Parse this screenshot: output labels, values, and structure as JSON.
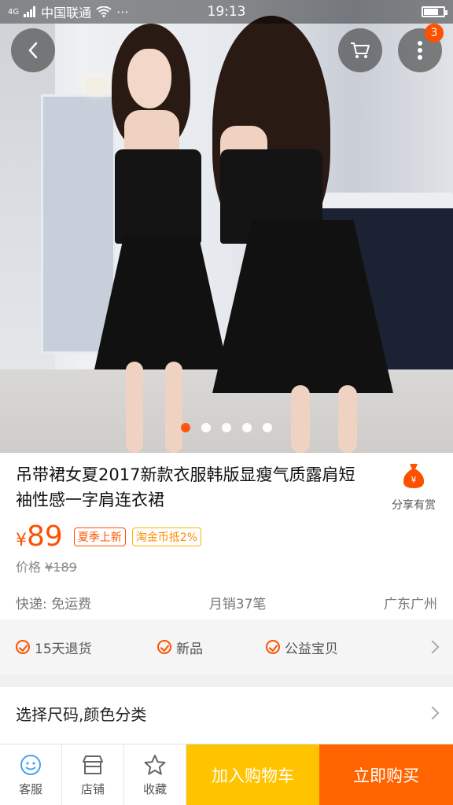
{
  "status_bar": {
    "network": "4G",
    "carrier": "中国联通",
    "more": "···",
    "time": "19:13",
    "battery_level": 0.75
  },
  "gallery": {
    "cart_badge_count": "3",
    "current_index": 1,
    "total": 5
  },
  "product": {
    "title": "吊带裙女夏2017新款衣服韩版显瘦气质露肩短袖性感一字肩连衣裙",
    "share_label": "分享有赏",
    "currency": "¥",
    "price": "89",
    "tags": [
      "夏季上新",
      "淘金币抵2%"
    ],
    "original_price_label": "价格",
    "original_price": "¥189",
    "shipping": "快递: 免运费",
    "monthly_sales": "月销37笔",
    "location": "广东广州"
  },
  "services": [
    "15天退货",
    "新品",
    "公益宝贝"
  ],
  "sku_select": {
    "label": "选择尺码,颜色分类"
  },
  "bottom_bar": {
    "service_label": "客服",
    "shop_label": "店铺",
    "favorite_label": "收藏",
    "add_to_cart": "加入购物车",
    "buy_now": "立即购买"
  },
  "colors": {
    "accent": "#ff5000",
    "cart_button": "#ffc300",
    "buy_button": "#ff6400"
  }
}
